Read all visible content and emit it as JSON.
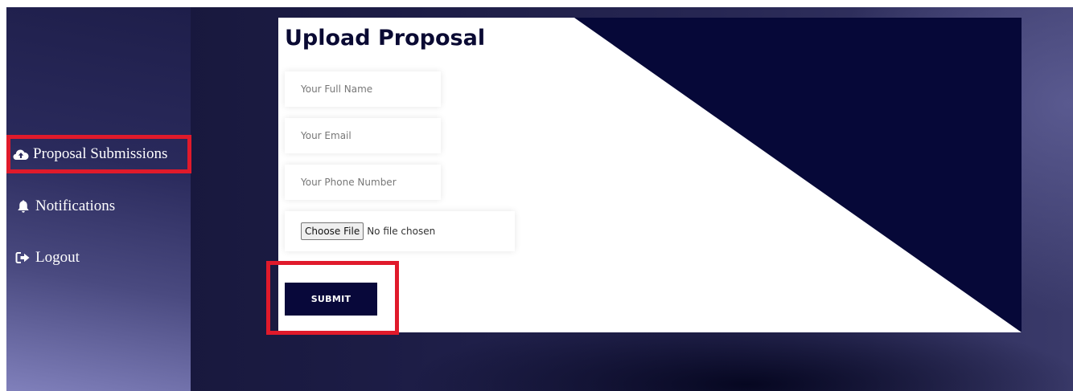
{
  "sidebar": {
    "items": [
      {
        "label": "Proposal Submissions",
        "icon": "cloud-upload-icon",
        "active": true
      },
      {
        "label": "Notifications",
        "icon": "bell-icon"
      },
      {
        "label": "Logout",
        "icon": "sign-out-icon"
      }
    ]
  },
  "form": {
    "title": "Upload Proposal",
    "name_placeholder": "Your Full Name",
    "email_placeholder": "Your Email",
    "phone_placeholder": "Your Phone Number",
    "file_button_label": "Choose File",
    "file_status": "No file chosen",
    "submit_label": "SUBMIT"
  },
  "colors": {
    "accent_navy": "#08083a",
    "highlight_red": "#e01a2b",
    "diagonal_navy": "#060838"
  }
}
